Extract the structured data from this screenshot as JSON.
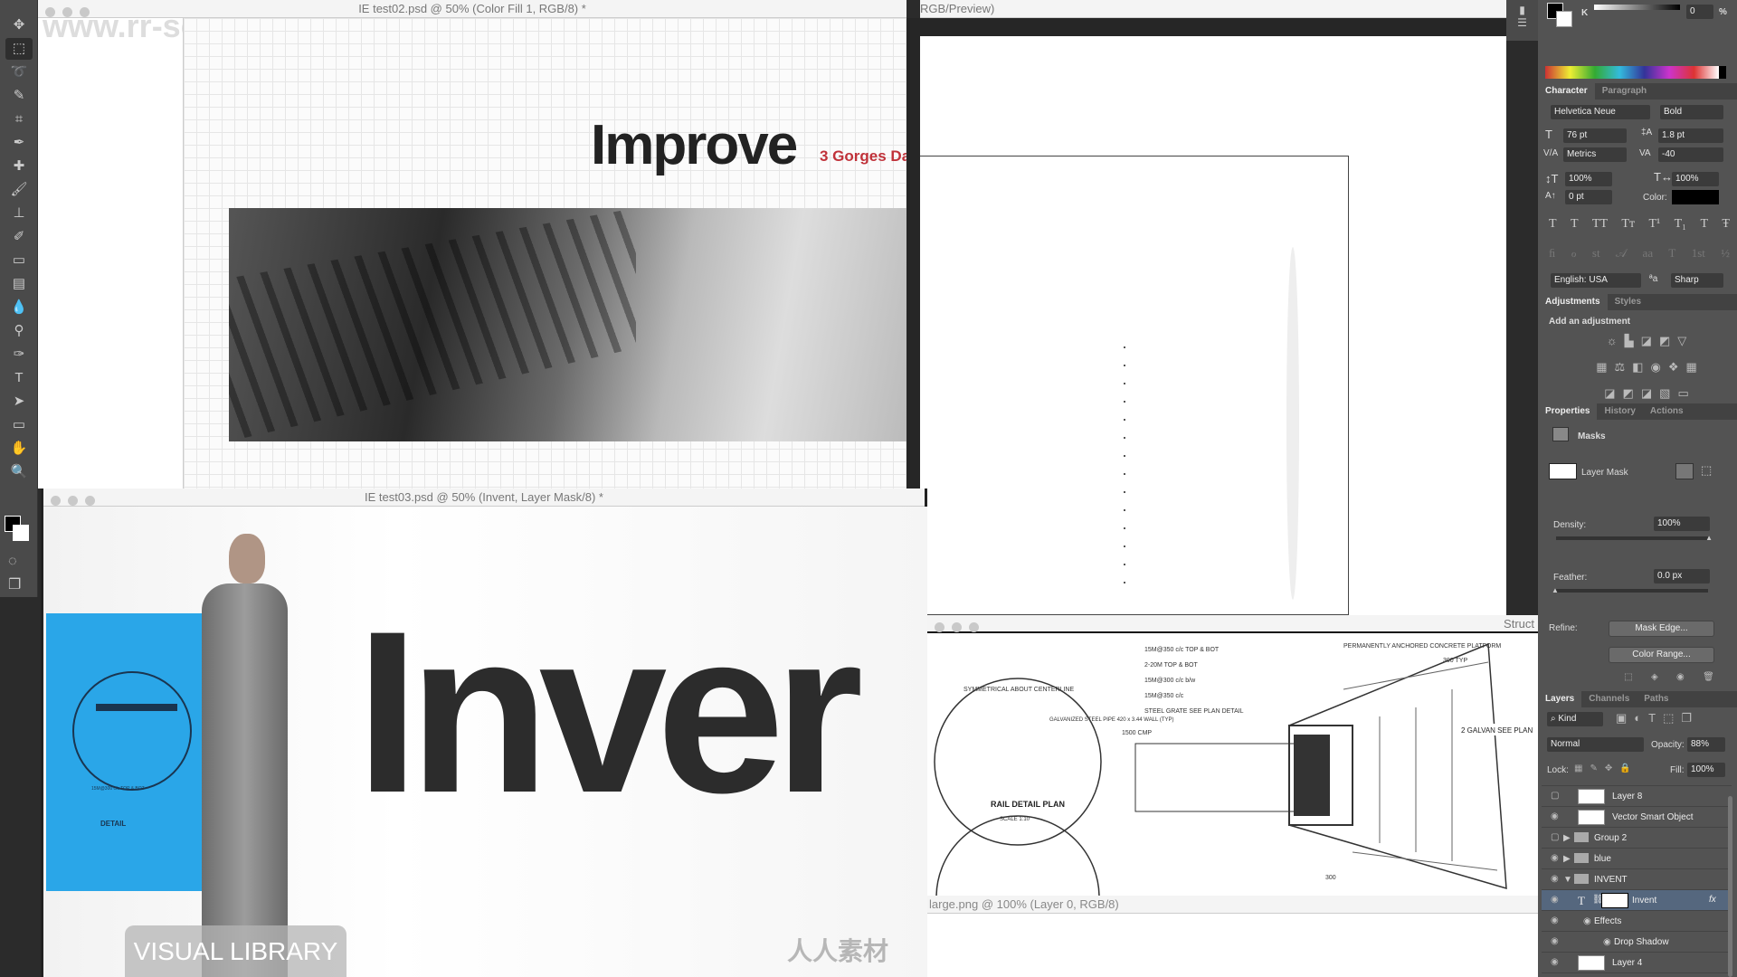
{
  "watermark": "www.rr-sc.com",
  "toolbar": {
    "tools": [
      "move-icon",
      "marquee-icon",
      "lasso-icon",
      "quick-select-icon",
      "crop-icon",
      "eyedropper-icon",
      "healing-icon",
      "brush-icon",
      "stamp-icon",
      "history-brush-icon",
      "eraser-icon",
      "gradient-icon",
      "blur-icon",
      "dodge-icon",
      "pen-icon",
      "type-icon",
      "path-select-icon",
      "rectangle-icon",
      "hand-icon",
      "zoom-icon"
    ],
    "glyphs": [
      "✥",
      "⬚",
      "➰",
      "✎",
      "⌗",
      "✒",
      "✚",
      "🖌",
      "⊥",
      "✐",
      "▭",
      "▤",
      "💧",
      "⚲",
      "✑",
      "T",
      "➤",
      "▭",
      "✋",
      "🔍"
    ]
  },
  "doc1": {
    "title": "IE test02.psd @ 50% (Color Fill 1, RGB/8) *",
    "headline": "Improve",
    "subhead": "3 Gorges Da"
  },
  "doc2": {
    "title": "RGB/Preview)"
  },
  "doc3": {
    "title": "Struct",
    "drawing_labels": [
      "15M@350 c/c TOP & BOT",
      "2-20M TOP & BOT",
      "15M@300 c/c b/w",
      "15M@350 c/c",
      "STEEL GRATE SEE PLAN DETAIL",
      "PERMANENTLY ANCHORED CONCRETE PLATFORM",
      "300 TYP",
      "SYMMETRICAL ABOUT CENTERLINE",
      "GALVANIZED STEEL PIPE 420 x 3.44 WALL (TYP)",
      "1500 CMP",
      "RAIL DETAIL PLAN",
      "SCALE 1:10",
      "2 GALVAN SEE PLAN",
      "300"
    ]
  },
  "doc4": {
    "title": "large.png @ 100% (Layer 0, RGB/8)"
  },
  "doc5": {
    "title": "IE test03.psd @ 50% (Invent, Layer Mask/8) *",
    "headline": "Inver",
    "overlay": "VISUAL LIBRARY",
    "blue": "#2aa6e8",
    "mini_labels": [
      "DETAIL",
      "15M@300 c/c TOP & BOT"
    ]
  },
  "color": {
    "channel": "K",
    "value": "0",
    "unit": "%"
  },
  "character": {
    "tabs": [
      "Character",
      "Paragraph"
    ],
    "font": "Helvetica Neue",
    "style": "Bold",
    "size": "76 pt",
    "leading": "1.8 pt",
    "kerning": "Metrics",
    "tracking": "-40",
    "vscale": "100%",
    "hscale": "100%",
    "baseline": "0 pt",
    "color_label": "Color:",
    "language": "English: USA",
    "aa": "Sharp",
    "type_buttons": [
      "T",
      "T",
      "TT",
      "Tт",
      "T¹",
      "T₁",
      "T",
      "Ŧ"
    ],
    "ot_buttons": [
      "ﬁ",
      "ℴ",
      "st",
      "𝒜",
      "aa",
      "T",
      "1st",
      "½"
    ]
  },
  "adjustments": {
    "tabs": [
      "Adjustments",
      "Styles"
    ],
    "heading": "Add an adjustment"
  },
  "properties": {
    "tabs": [
      "Properties",
      "History",
      "Actions"
    ],
    "section": "Masks",
    "mask_label": "Layer Mask",
    "density_label": "Density:",
    "density": "100%",
    "density_value": 100,
    "feather_label": "Feather:",
    "feather": "0.0 px",
    "feather_value": 0,
    "refine_label": "Refine:",
    "mask_edge": "Mask Edge...",
    "color_range": "Color Range..."
  },
  "layers": {
    "tabs": [
      "Layers",
      "Channels",
      "Paths"
    ],
    "filter": "Kind",
    "blend": "Normal",
    "opacity_label": "Opacity:",
    "opacity": "88%",
    "lock_label": "Lock:",
    "fill_label": "Fill:",
    "fill": "100%",
    "items": [
      {
        "name": "Layer 8",
        "visible": false
      },
      {
        "name": "Vector Smart Object",
        "visible": true
      },
      {
        "name": "Group 2",
        "visible": false,
        "folder": true
      },
      {
        "name": "blue",
        "visible": true,
        "folder": true
      },
      {
        "name": "INVENT",
        "visible": true,
        "folder": true,
        "open": true
      },
      {
        "name": "Invent",
        "visible": true,
        "selected": true,
        "fx": "fx"
      },
      {
        "name": "Effects",
        "visible": true,
        "sub": true
      },
      {
        "name": "Drop Shadow",
        "visible": true,
        "sub": true
      },
      {
        "name": "Layer 4",
        "visible": true
      }
    ]
  },
  "brand": "人人素材"
}
